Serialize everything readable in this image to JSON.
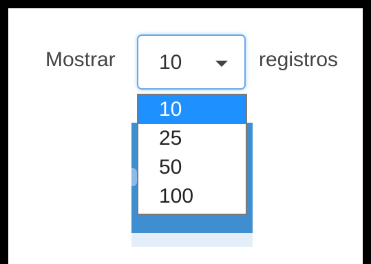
{
  "length_control": {
    "label_before": "Mostrar",
    "label_after": "registros",
    "selected_value": "10",
    "options": [
      "10",
      "25",
      "50",
      "100"
    ],
    "selected_index": 0
  },
  "colors": {
    "focus_border": "#6aa8e8",
    "selected_option_bg": "#1e90ff",
    "backdrop_blue": "#3f8ed0"
  }
}
